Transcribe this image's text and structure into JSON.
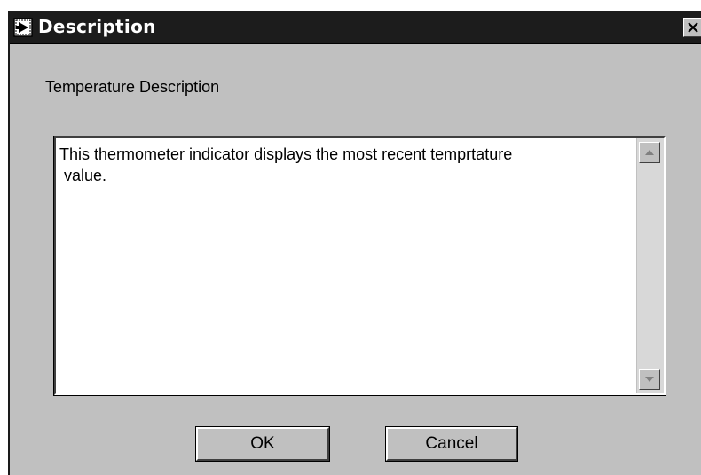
{
  "window": {
    "title": "Description",
    "icon": "app-icon",
    "close_icon": "close-icon"
  },
  "dialog": {
    "label": "Temperature Description",
    "description_text": "This thermometer indicator displays the most recent temprtature\n value.",
    "buttons": {
      "ok_label": "OK",
      "cancel_label": "Cancel"
    }
  },
  "colors": {
    "titlebar": "#1c1c1c",
    "window_bg": "#c0c0c0",
    "text_bg": "#ffffff"
  }
}
